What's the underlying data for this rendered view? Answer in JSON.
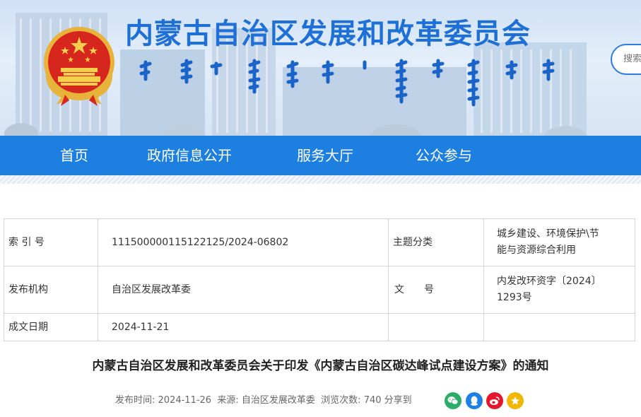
{
  "header": {
    "title": "内蒙古自治区发展和改革委员会",
    "search_placeholder": "搜索",
    "colors": {
      "title": "#1e6fd6",
      "nav": "#1d7fe0"
    }
  },
  "nav": {
    "items": [
      "首页",
      "政府信息公开",
      "服务大厅",
      "公众参与"
    ]
  },
  "info_table": {
    "index_label": "索 引 号",
    "index_value": "11150000011512212​5/2024-06802",
    "topic_label": "主题分类",
    "topic_value_line1": "城乡建设、环境保护\\节",
    "topic_value_line2": "能与资源综合利用",
    "publisher_label": "发布机构",
    "publisher_value": "自治区发展改革委",
    "docno_label": "文　　号",
    "docno_value_line1": "内发改环资字〔2024〕",
    "docno_value_line2": "1293号",
    "date_label": "成文日期",
    "date_value": "2024-11-21"
  },
  "document": {
    "title": "内蒙古自治区发展和改革委员会关于印发《内蒙古自治区碳达峰试点建设方案》的通知"
  },
  "meta": {
    "publish_label": "发布时间:",
    "publish_date": "2024-11-26",
    "source_label": "来源:",
    "source": "自治区发展改革委",
    "views_label": "浏览次数:",
    "views": "740",
    "share_label": "分享到"
  },
  "share": [
    {
      "name": "wechat-icon",
      "color": "#2aae67"
    },
    {
      "name": "qq-icon",
      "color": "#1e80e6"
    },
    {
      "name": "weibo-icon",
      "color": "#e6162d"
    },
    {
      "name": "qzone-icon",
      "color": "#f2b705"
    }
  ]
}
